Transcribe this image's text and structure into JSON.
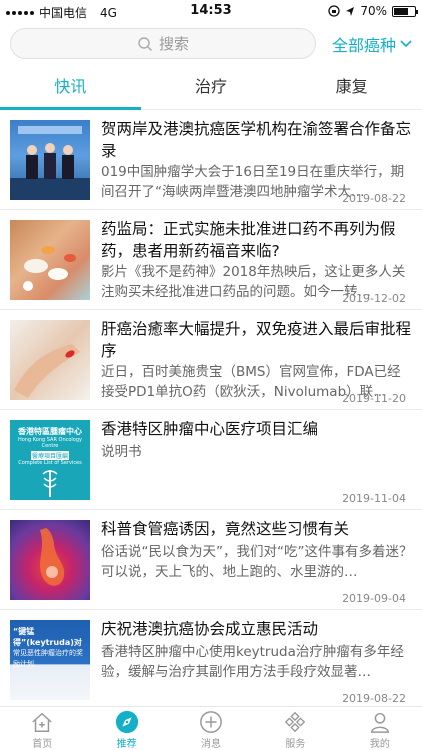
{
  "status_bar": {
    "carrier": "中国电信",
    "network": "4G",
    "time": "14:53",
    "battery": "70%",
    "battery_level": 0.7
  },
  "search": {
    "placeholder": "搜索",
    "category_label": "全部癌种"
  },
  "tabs": [
    {
      "label": "快讯",
      "active": true
    },
    {
      "label": "治疗",
      "active": false
    },
    {
      "label": "康复",
      "active": false
    }
  ],
  "news": [
    {
      "title": "贺两岸及港澳抗癌医学机构在渝签署合作备忘录",
      "summary": "019中国肿瘤学大会于16日至19日在重庆举行，期间召开了“海峡两岸暨港澳四地肿瘤学术大…",
      "date": "2019-08-22"
    },
    {
      "title": "药监局：正式实施未批准进口药不再列为假药，患者用新药福音来临?",
      "summary": "影片《我不是药神》2018年热映后，这让更多人关注购买未经批准进口药品的问题。如今一转…",
      "date": "2019-12-02"
    },
    {
      "title": "肝癌治癒率大幅提升，双免疫进入最后审批程序",
      "summary": "近日，百时美施贵宝（BMS）官网宣佈，FDA已经接受PD1单抗O药（欧狄沃，Nivolumab）联…",
      "date": "2019-11-20"
    },
    {
      "title": "香港特区肿瘤中心医疗项目汇编",
      "summary": "说明书",
      "date": "2019-11-04",
      "thumb_text": [
        "香港特區腫瘤中心",
        "Hong Kong SAR Oncology Centre",
        "醫療項目匯編",
        "Complete List of Services"
      ]
    },
    {
      "title": "科普食管癌诱因，竟然这些习惯有关",
      "summary": "俗话说“民以食为天”，我们对“吃”这件事有多着迷？可以说，天上飞的、地上跑的、水里游的…",
      "date": "2019-09-04"
    },
    {
      "title": "庆祝港澳抗癌协会成立惠民活动",
      "summary": "香港特区肿瘤中心使用keytruda治疗肿瘤有多年经验，缓解与治疗其副作用方法手段疗效显著…",
      "date": "2019-08-22",
      "thumb_text": [
        "“键锰得”(keytruda)对",
        "常见恶性肿瘤治疗的奖励计划"
      ]
    }
  ],
  "bottom_nav": [
    {
      "label": "首页",
      "icon": "home-icon",
      "active": false
    },
    {
      "label": "推荐",
      "icon": "compass-icon",
      "active": true
    },
    {
      "label": "消息",
      "icon": "plus-circle-icon",
      "active": false
    },
    {
      "label": "服务",
      "icon": "grid-icon",
      "active": false
    },
    {
      "label": "我的",
      "icon": "user-icon",
      "active": false
    }
  ],
  "colors": {
    "accent": "#13b0c8"
  }
}
